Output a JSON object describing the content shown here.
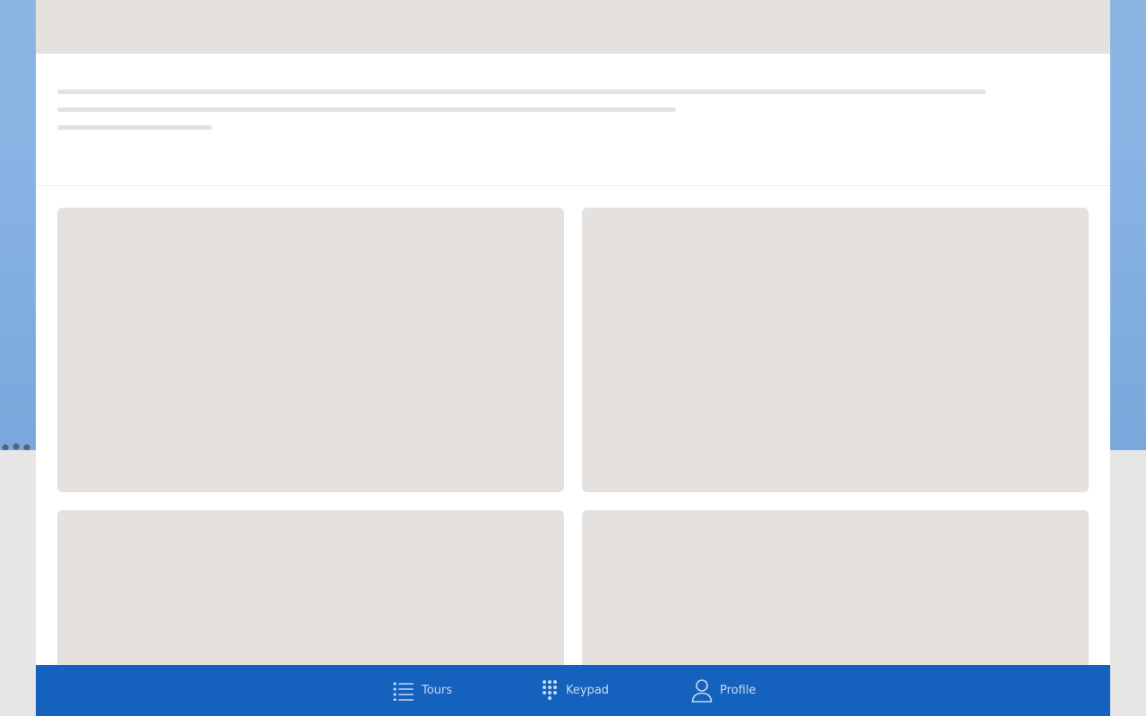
{
  "colors": {
    "nav_background": "#1461be",
    "nav_text": "#c6d8f0",
    "skeleton": "#e5e1de",
    "sky": "#87b3e4"
  },
  "bottom_nav": {
    "items": [
      {
        "label": "Tours",
        "icon": "list-icon"
      },
      {
        "label": "Keypad",
        "icon": "keypad-icon"
      },
      {
        "label": "Profile",
        "icon": "user-icon"
      }
    ]
  }
}
